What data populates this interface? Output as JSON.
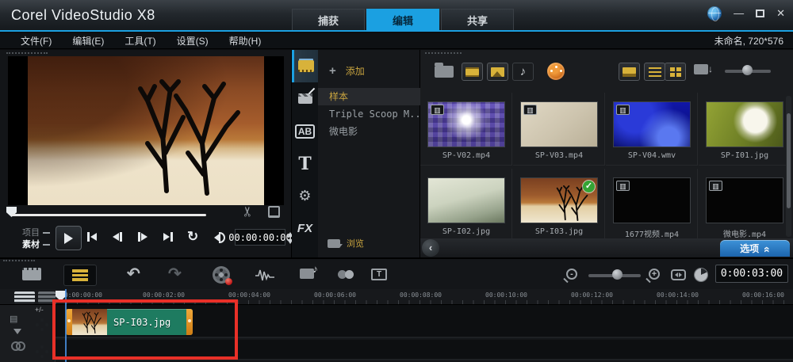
{
  "colors": {
    "accent_blue": "#1ba0e1",
    "gold_text": "#c9a43f",
    "clip_green": "#1e7b60",
    "clip_handle_orange": "#e8951e",
    "annotation_red": "#e83028",
    "options_button_blue": "#2f7fc4"
  },
  "title_bar": {
    "app_title": "Corel VideoStudio X8",
    "tabs": [
      {
        "label": "捕获"
      },
      {
        "label": "编辑"
      },
      {
        "label": "共享"
      }
    ],
    "minimize_glyph": "—",
    "close_glyph": "✕"
  },
  "menu_bar": {
    "items": [
      "文件(F)",
      "编辑(E)",
      "工具(T)",
      "设置(S)",
      "帮助(H)"
    ],
    "project_info": "未命名, 720*576"
  },
  "preview": {
    "project_label": "项目",
    "clip_label": "素材",
    "timecode": "00:00:00:00"
  },
  "nav_rail": {
    "transition_label": "AB",
    "title_label": "T",
    "filter_label": "FX",
    "gear_glyph": "⚙"
  },
  "sample_panel": {
    "add_label": "添加",
    "plus_glyph": "+",
    "items": [
      {
        "label": "样本",
        "selected": true
      },
      {
        "label": "Triple Scoop M...",
        "selected": false
      },
      {
        "label": "微电影",
        "selected": false
      }
    ],
    "browse_label": "浏览"
  },
  "library": {
    "music_glyph": "♪",
    "video_badge_glyph": "▥",
    "check_glyph": "✓",
    "back_glyph": "‹",
    "options_label": "选项",
    "chevron_glyph": "«",
    "items": [
      {
        "name": "SP-V02.mp4",
        "type": "video"
      },
      {
        "name": "SP-V03.mp4",
        "type": "video"
      },
      {
        "name": "SP-V04.wmv",
        "type": "video"
      },
      {
        "name": "SP-I01.jpg",
        "type": "photo"
      },
      {
        "name": "SP-I02.jpg",
        "type": "photo"
      },
      {
        "name": "SP-I03.jpg",
        "type": "photo",
        "checked": true
      },
      {
        "name": "1677视频.mp4",
        "type": "video"
      },
      {
        "name": "微电影.mp4",
        "type": "video"
      }
    ]
  },
  "timeline": {
    "undo_glyph": "↶",
    "redo_glyph": "↷",
    "repeat_glyph": "↻",
    "zoom_out_glyph": "-",
    "zoom_in_glyph": "+",
    "subtitle_glyph": "T",
    "timecode": "0:00:03:00",
    "track_add_label": "+/-",
    "camlist_glyph": "▤",
    "ruler": [
      "00:00:00:00",
      "00:00:02:00",
      "00:00:04:00",
      "00:00:06:00",
      "00:00:08:00",
      "00:00:10:00",
      "00:00:12:00",
      "00:00:14:00",
      "00:00:16:00"
    ],
    "clip_name": "SP-I03.jpg"
  }
}
